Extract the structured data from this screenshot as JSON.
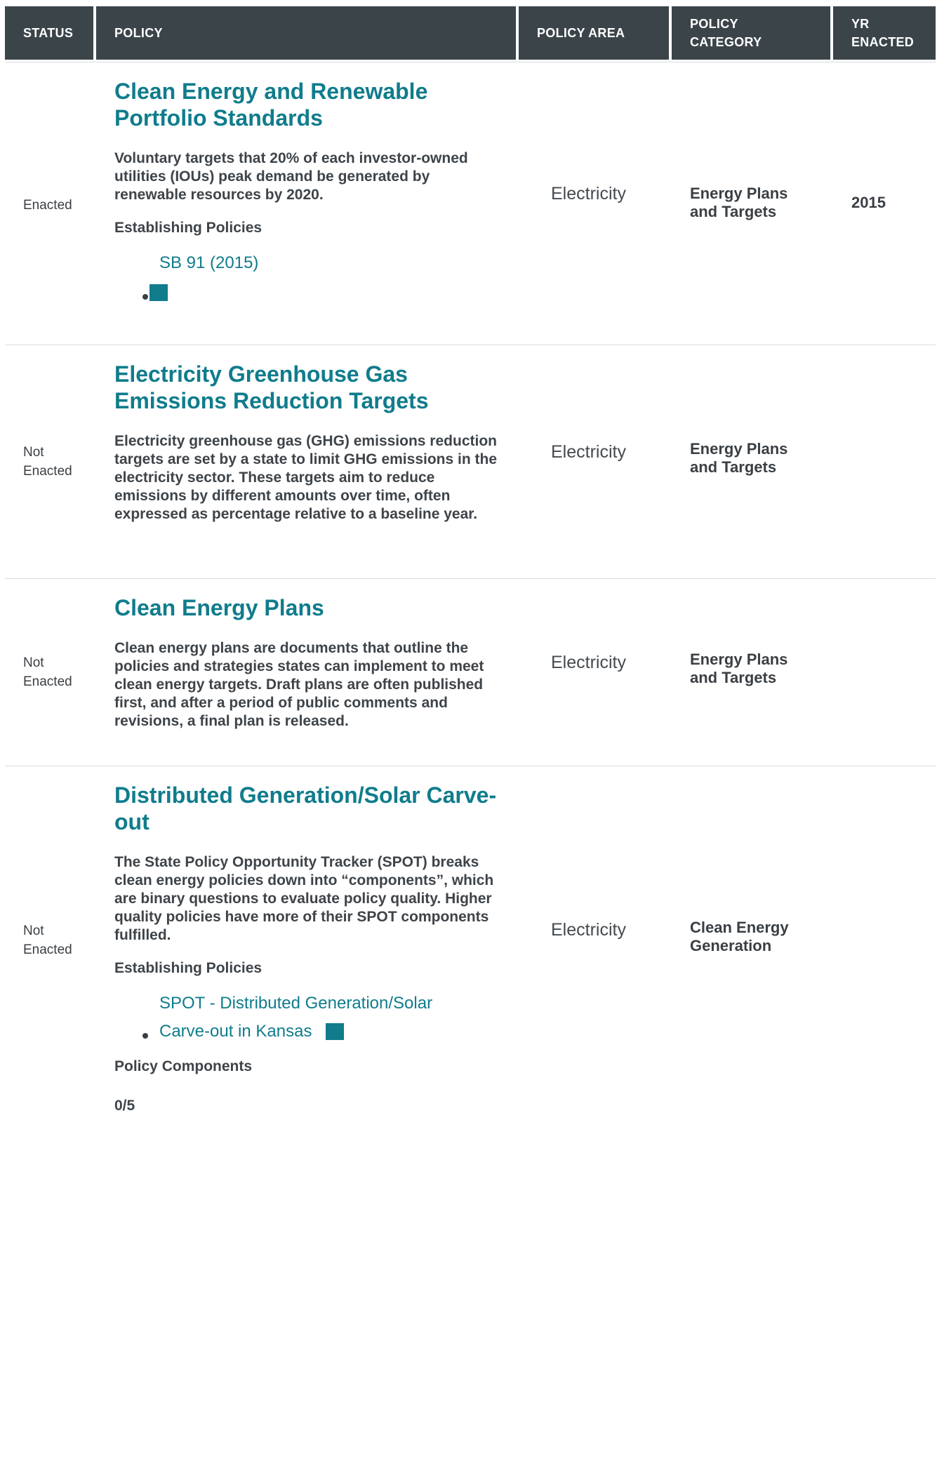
{
  "header": {
    "status": "STATUS",
    "policy": "POLICY",
    "policy_area": "POLICY AREA",
    "policy_category_1": "POLICY",
    "policy_category_2": "CATEGORY",
    "yr_enacted_1": "YR",
    "yr_enacted_2": "ENACTED"
  },
  "rows": [
    {
      "status_1": "Enacted",
      "status_2": "",
      "title_1": "Clean Energy and Renewable",
      "title_2": "Portfolio Standards",
      "description": "Voluntary targets that 20% of each investor-owned utilities (IOUs) peak demand be generated by renewable resources by 2020.",
      "establishing_label": "Establishing Policies",
      "link_1": "SB 91 (2015)",
      "link_icon": "document-icon",
      "area": "Electricity",
      "category_1": "Energy Plans",
      "category_2": "and Targets",
      "year": "2015"
    },
    {
      "status_1": "Not",
      "status_2": "Enacted",
      "title_1": "Electricity Greenhouse Gas",
      "title_2": "Emissions Reduction Targets",
      "description": "Electricity greenhouse gas (GHG) emissions reduction targets are set by a state to limit GHG emissions in the electricity sector. These targets aim to reduce emissions by different amounts over time, often expressed as percentage relative to a baseline year.",
      "area": "Electricity",
      "category_1": "Energy Plans",
      "category_2": "and Targets",
      "year": ""
    },
    {
      "status_1": "Not",
      "status_2": "Enacted",
      "title_1": "Clean Energy Plans",
      "description": "Clean energy plans are documents that outline the policies and strategies states can implement to meet clean energy targets. Draft plans are often published first, and after a period of public comments and revisions, a final plan is released.",
      "area": "Electricity",
      "category_1": "Energy Plans",
      "category_2": "and Targets",
      "year": ""
    },
    {
      "status_1": "Not",
      "status_2": "Enacted",
      "title_1": "Distributed Generation/Solar Carve-",
      "title_2": "out",
      "description": "The State Policy Opportunity Tracker (SPOT) breaks clean energy policies down into “components”, which are binary questions to evaluate policy quality. Higher quality policies have more of their SPOT components fulfilled.",
      "establishing_label": "Establishing Policies",
      "link_1": "SPOT - Distributed Generation/Solar",
      "link_2": "Carve-out in Kansas",
      "link_icon": "document-icon",
      "components_label": "Policy Components",
      "components_count": "0/5",
      "area": "Electricity",
      "category_1": "Clean Energy",
      "category_2": "Generation",
      "year": ""
    }
  ],
  "colors": {
    "header_bg": "#3b4449",
    "accent": "#107c8c",
    "text": "#3a3f44"
  }
}
